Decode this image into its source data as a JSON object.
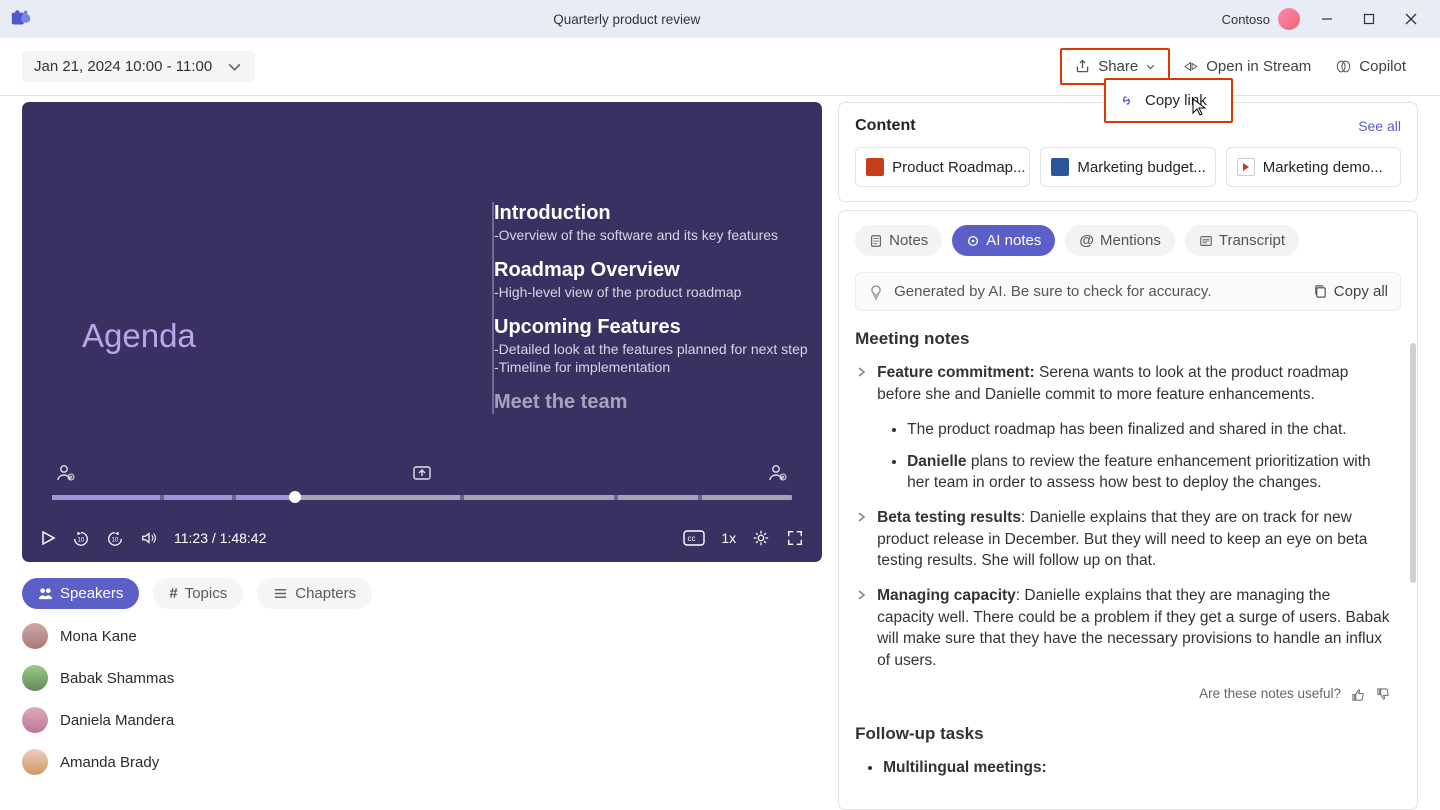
{
  "titlebar": {
    "title": "Quarterly product review",
    "account": "Contoso"
  },
  "toolbar": {
    "daterange": "Jan 21, 2024 10:00 - 11:00",
    "share": "Share",
    "open_in_stream": "Open in Stream",
    "copilot": "Copilot",
    "copy_link": "Copy link"
  },
  "video": {
    "agenda_label": "Agenda",
    "items": [
      {
        "title": "Introduction",
        "subs": [
          "-Overview of the software and its key features"
        ]
      },
      {
        "title": "Roadmap Overview",
        "subs": [
          "-High-level view of the product roadmap"
        ]
      },
      {
        "title": "Upcoming Features",
        "subs": [
          "-Detailed look at the features planned for next step",
          "-Timeline for implementation"
        ]
      },
      {
        "title": "Meet the team",
        "subs": []
      }
    ],
    "current": "11:23",
    "duration": "1:48:42",
    "speed": "1x"
  },
  "vtabs": {
    "speakers": "Speakers",
    "topics": "Topics",
    "chapters": "Chapters"
  },
  "speakers": [
    {
      "name": "Mona Kane",
      "color": "#2e7ad1"
    },
    {
      "name": "Babak Shammas",
      "color": "#6bb23a"
    },
    {
      "name": "Daniela Mandera",
      "color": "#9b3fbf"
    },
    {
      "name": "Amanda Brady",
      "color": "#888"
    }
  ],
  "right": {
    "content_title": "Content",
    "see_all": "See all",
    "docs": [
      {
        "label": "Product Roadmap...",
        "type": "ppt"
      },
      {
        "label": "Marketing budget...",
        "type": "word"
      },
      {
        "label": "Marketing demo...",
        "type": "vid"
      }
    ],
    "ntabs": {
      "notes": "Notes",
      "ai_notes": "AI notes",
      "mentions": "Mentions",
      "transcript": "Transcript"
    },
    "ai_banner": "Generated by AI. Be sure to check for accuracy.",
    "copy_all": "Copy all",
    "meeting_notes_hdr": "Meeting notes",
    "notes": [
      {
        "bold": "Feature commitment:",
        "rest": " Serena wants to look at the product roadmap before she and Danielle commit to more feature enhancements."
      },
      {
        "bold": "Beta testing results",
        "rest": ": Danielle explains that they are on track for new product release in December. But they will need to keep an eye on beta testing results. She will follow up on that."
      },
      {
        "bold": "Managing capacity",
        "rest": ": Danielle explains that they are managing the capacity well. There could be a problem if they get a surge of users. Babak will make sure that they have the necessary provisions to handle an influx of users."
      }
    ],
    "sub_bullets": [
      "The product roadmap has been finalized and shared in the chat.",
      {
        "bold": "Danielle",
        "rest": " plans to review the feature enhancement prioritization with her team in order to assess how best to deploy the changes."
      }
    ],
    "feedback": "Are these notes useful?",
    "followup_hdr": "Follow-up tasks",
    "followup_item": "Multilingual meetings:"
  }
}
